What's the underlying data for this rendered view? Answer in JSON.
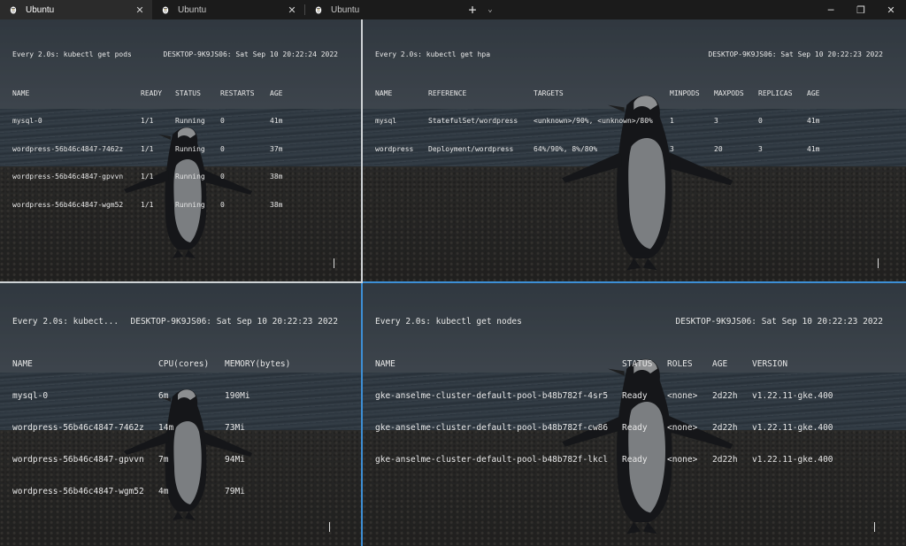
{
  "tabs": [
    {
      "label": "Ubuntu",
      "active": true,
      "close": "✕"
    },
    {
      "label": "Ubuntu",
      "active": false,
      "close": "✕"
    },
    {
      "label": "Ubuntu",
      "active": false,
      "close": ""
    }
  ],
  "titlebar": {
    "new_tab": "+",
    "dropdown": "⌄",
    "minimize": "─",
    "maximize": "❐",
    "close": "✕"
  },
  "panes": {
    "pods": {
      "command": "Every 2.0s: kubectl get pods",
      "host": "DESKTOP-9K9JS06: Sat Sep 10 20:22:24 2022",
      "columns": [
        "NAME",
        "READY",
        "STATUS",
        "RESTARTS",
        "AGE"
      ],
      "rows": [
        [
          "mysql-0",
          "1/1",
          "Running",
          "0",
          "41m"
        ],
        [
          "wordpress-56b46c4847-7462z",
          "1/1",
          "Running",
          "0",
          "37m"
        ],
        [
          "wordpress-56b46c4847-gpvvn",
          "1/1",
          "Running",
          "0",
          "38m"
        ],
        [
          "wordpress-56b46c4847-wgm52",
          "1/1",
          "Running",
          "0",
          "38m"
        ]
      ]
    },
    "hpa": {
      "command": "Every 2.0s: kubectl get hpa",
      "host": "DESKTOP-9K9JS06: Sat Sep 10 20:22:23 2022",
      "columns": [
        "NAME",
        "REFERENCE",
        "TARGETS",
        "MINPODS",
        "MAXPODS",
        "REPLICAS",
        "AGE"
      ],
      "rows": [
        [
          "mysql",
          "StatefulSet/wordpress",
          "<unknown>/90%, <unknown>/80%",
          "1",
          "3",
          "0",
          "41m"
        ],
        [
          "wordpress",
          "Deployment/wordpress",
          "64%/90%, 8%/80%",
          "3",
          "20",
          "3",
          "41m"
        ]
      ]
    },
    "top": {
      "command": "Every 2.0s: kubect...",
      "host": "DESKTOP-9K9JS06: Sat Sep 10 20:22:23 2022",
      "columns": [
        "NAME",
        "CPU(cores)",
        "MEMORY(bytes)"
      ],
      "rows": [
        [
          "mysql-0",
          "6m",
          "190Mi"
        ],
        [
          "wordpress-56b46c4847-7462z",
          "14m",
          "73Mi"
        ],
        [
          "wordpress-56b46c4847-gpvvn",
          "7m",
          "94Mi"
        ],
        [
          "wordpress-56b46c4847-wgm52",
          "4m",
          "79Mi"
        ]
      ]
    },
    "nodes": {
      "command": "Every 2.0s: kubectl get nodes",
      "host": "DESKTOP-9K9JS06: Sat Sep 10 20:22:23 2022",
      "columns": [
        "NAME",
        "STATUS",
        "ROLES",
        "AGE",
        "VERSION"
      ],
      "rows": [
        [
          "gke-anselme-cluster-default-pool-b48b782f-4sr5",
          "Ready",
          "<none>",
          "2d22h",
          "v1.22.11-gke.400"
        ],
        [
          "gke-anselme-cluster-default-pool-b48b782f-cw86",
          "Ready",
          "<none>",
          "2d22h",
          "v1.22.11-gke.400"
        ],
        [
          "gke-anselme-cluster-default-pool-b48b782f-lkcl",
          "Ready",
          "<none>",
          "2d22h",
          "v1.22.11-gke.400"
        ]
      ]
    }
  },
  "icons": {
    "tab": "linux-tux-icon",
    "background": "penguin-beach-image"
  },
  "colors": {
    "focus_border": "#3d8fd6",
    "text": "#e8e8e8",
    "titlebar": "#1b1b1b"
  }
}
